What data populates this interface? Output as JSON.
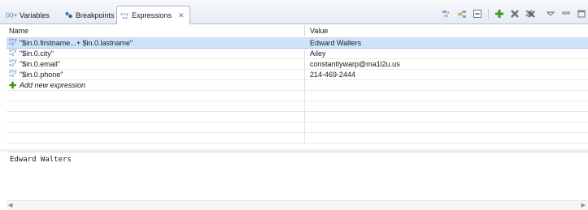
{
  "tabs": [
    {
      "label": "Variables",
      "icon": "variables-icon",
      "icon_text": "(x)="
    },
    {
      "label": "Breakpoints",
      "icon": "breakpoints-icon"
    },
    {
      "label": "Expressions",
      "icon": "expressions-icon",
      "active": true
    }
  ],
  "toolbar": {
    "icons": [
      "show-type-names-icon",
      "show-logical-structure-icon",
      "collapse-all-icon",
      "add-expression-icon",
      "remove-expression-icon",
      "remove-all-expressions-icon",
      "view-menu-icon",
      "minimize-icon",
      "maximize-icon"
    ]
  },
  "table": {
    "columns": [
      "Name",
      "Value"
    ],
    "rows": [
      {
        "name": "\"$in.0.firstname...+ $in.0.lastname\"",
        "value": "Edward Walters",
        "selected": true
      },
      {
        "name": "\"$in.0.city\"",
        "value": "Ailey"
      },
      {
        "name": "\"$in.0.email\"",
        "value": "constantlywarp@ma1l2u.us"
      },
      {
        "name": "\"$in.0.phone\"",
        "value": "214-469-2444"
      }
    ],
    "add_label": "Add new expression"
  },
  "details": {
    "text": "Edward Walters"
  },
  "colors": {
    "selection": "#cfe3fb",
    "add_green": "#3a9a1a",
    "remove_grey": "#707070"
  }
}
